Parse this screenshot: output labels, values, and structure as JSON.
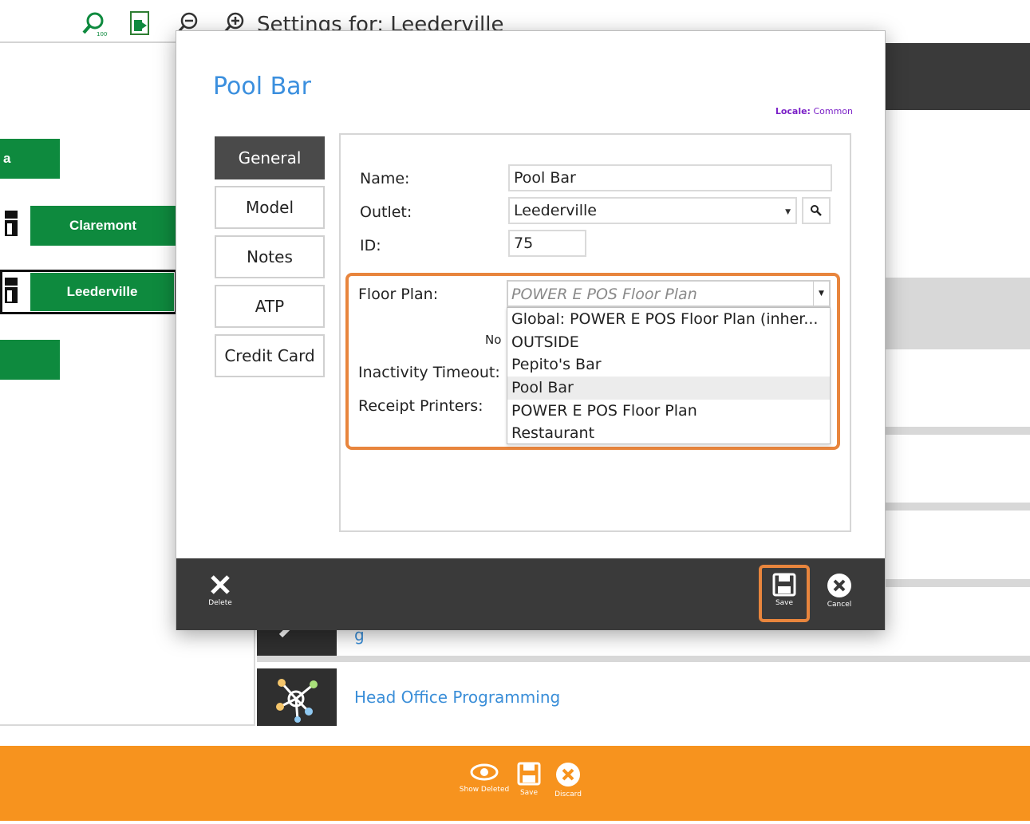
{
  "toolbar": {
    "title": "Settings for: Leederville",
    "icons": [
      "zoom-100-icon",
      "fit-page-icon",
      "zoom-out-icon",
      "zoom-in-icon"
    ]
  },
  "left_panel": {
    "stores": [
      {
        "label": "a"
      },
      {
        "label": "Claremont"
      },
      {
        "label": "Leederville"
      },
      {
        "label": ""
      }
    ]
  },
  "menu": {
    "items": [
      {
        "label": "g"
      },
      {
        "label": "Head Office Programming"
      }
    ]
  },
  "bottom_bar": {
    "show_deleted": "Show Deleted",
    "save": "Save",
    "discard": "Discard"
  },
  "modal": {
    "title": "Pool Bar",
    "locale_label": "Locale:",
    "locale_value": "Common",
    "tabs": [
      "General",
      "Model",
      "Notes",
      "ATP",
      "Credit Card"
    ],
    "active_tab": "General",
    "form": {
      "name_label": "Name:",
      "name_value": "Pool Bar",
      "outlet_label": "Outlet:",
      "outlet_value": "Leederville",
      "id_label": "ID:",
      "id_value": "75",
      "floor_plan_label": "Floor Plan:",
      "floor_plan_value": "POWER E POS Floor Plan",
      "no_text": "No",
      "inactivity_label": "Inactivity Timeout:",
      "receipt_label": "Receipt Printers:"
    },
    "floor_plan_options": [
      "Global: POWER E POS Floor Plan (inher...",
      "OUTSIDE",
      "Pepito's Bar",
      "Pool Bar",
      "POWER E POS Floor Plan",
      "Restaurant"
    ],
    "footer": {
      "delete": "Delete",
      "save": "Save",
      "cancel": "Cancel"
    }
  },
  "colors": {
    "accent_orange": "#f7931e",
    "highlight_orange": "#e8853d",
    "title_blue": "#3b8fde",
    "store_green": "#0e8a3e",
    "locale_purple": "#7a1fc7",
    "dark_footer": "#3a3a3a"
  }
}
